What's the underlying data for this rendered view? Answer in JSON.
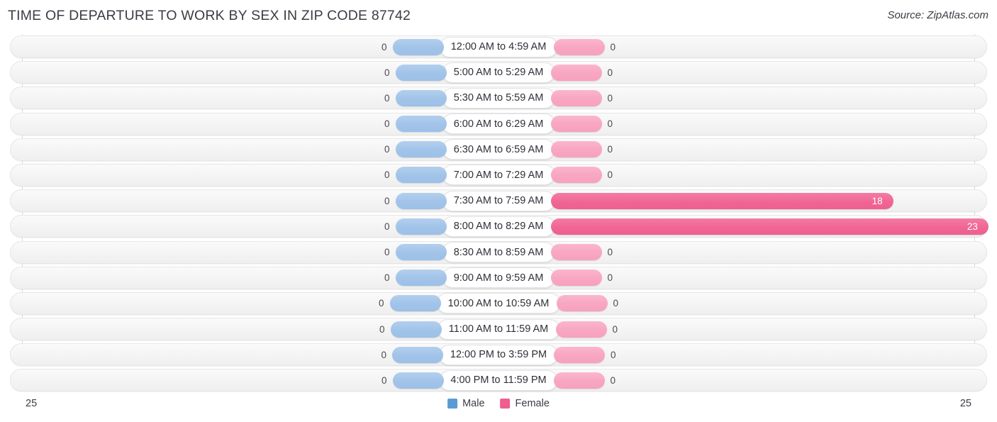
{
  "header": {
    "title": "TIME OF DEPARTURE TO WORK BY SEX IN ZIP CODE 87742",
    "source": "Source: ZipAtlas.com"
  },
  "legend": {
    "male_label": "Male",
    "female_label": "Female",
    "male_color": "#5b9bd5",
    "female_color": "#ee5f8e"
  },
  "axis": {
    "left_label": "25",
    "right_label": "25"
  },
  "chart_data": {
    "type": "bar",
    "orientation": "horizontal-diverging",
    "title": "TIME OF DEPARTURE TO WORK BY SEX IN ZIP CODE 87742",
    "xlabel": "",
    "ylabel": "",
    "xlim": [
      25,
      25
    ],
    "grid": true,
    "legend_position": "bottom-center",
    "categories": [
      "12:00 AM to 4:59 AM",
      "5:00 AM to 5:29 AM",
      "5:30 AM to 5:59 AM",
      "6:00 AM to 6:29 AM",
      "6:30 AM to 6:59 AM",
      "7:00 AM to 7:29 AM",
      "7:30 AM to 7:59 AM",
      "8:00 AM to 8:29 AM",
      "8:30 AM to 8:59 AM",
      "9:00 AM to 9:59 AM",
      "10:00 AM to 10:59 AM",
      "11:00 AM to 11:59 AM",
      "12:00 PM to 3:59 PM",
      "4:00 PM to 11:59 PM"
    ],
    "series": [
      {
        "name": "Male",
        "values": [
          0,
          0,
          0,
          0,
          0,
          0,
          0,
          0,
          0,
          0,
          0,
          0,
          0,
          0
        ]
      },
      {
        "name": "Female",
        "values": [
          0,
          0,
          0,
          0,
          0,
          0,
          18,
          23,
          0,
          0,
          0,
          0,
          0,
          0
        ]
      }
    ]
  }
}
